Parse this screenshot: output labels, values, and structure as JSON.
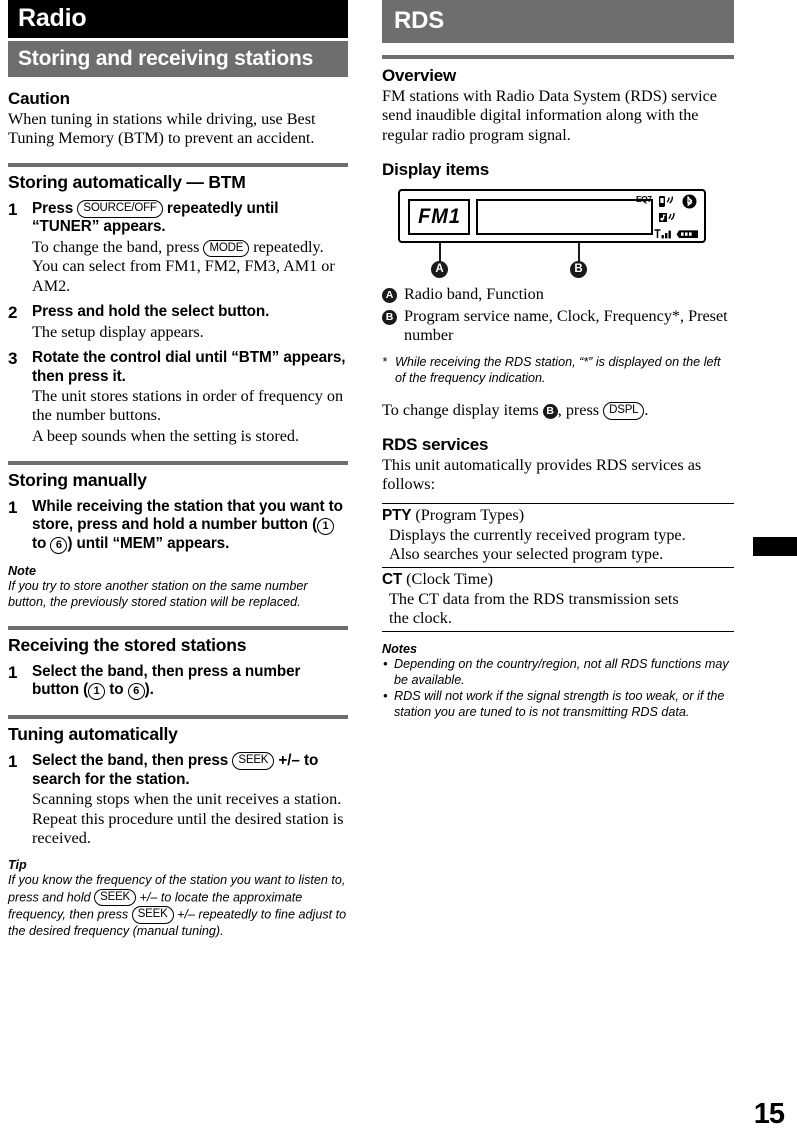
{
  "page_number": "15",
  "left_column": {
    "banner_title": "Radio",
    "banner_subtitle": "Storing and receiving stations",
    "caution": {
      "heading": "Caution",
      "text": "When tuning in stations while driving, use Best Tuning Memory (BTM) to prevent an accident."
    },
    "section_btm": {
      "heading": "Storing automatically — BTM",
      "steps": [
        {
          "num": "1",
          "title_pre": "Press",
          "button": "SOURCE/OFF",
          "title_post": "repeatedly until “TUNER” appears.",
          "desc_pre": "To change the band, press",
          "desc_button": "MODE",
          "desc_post": "repeatedly. You can select from FM1, FM2, FM3, AM1 or AM2."
        },
        {
          "num": "2",
          "title": "Press and hold the select button.",
          "desc": "The setup display appears."
        },
        {
          "num": "3",
          "title": "Rotate the control dial until “BTM” appears, then press it.",
          "desc": "The unit stores stations in order of frequency on the number buttons.",
          "desc2": "A beep sounds when the setting is stored."
        }
      ]
    },
    "section_manual": {
      "heading": "Storing manually",
      "step": {
        "num": "1",
        "title_pre": "While receiving the station that you want to store, press and hold a number button (",
        "btn_from": "1",
        "btn_mid": "to",
        "btn_to": "6",
        "title_post": ") until “MEM” appears."
      },
      "note_head": "Note",
      "note_body": "If you try to store another station on the same number button, the previously stored station will be replaced."
    },
    "section_receiving": {
      "heading": "Receiving the stored stations",
      "step": {
        "num": "1",
        "title_pre": "Select the band, then press a number button (",
        "btn_from": "1",
        "btn_mid": "to",
        "btn_to": "6",
        "title_post": ")."
      }
    },
    "section_tuning": {
      "heading": "Tuning automatically",
      "step": {
        "num": "1",
        "title_pre": "Select the band, then press",
        "button": "SEEK",
        "title_mid": "+/–",
        "title_post": "to search for the station.",
        "desc": "Scanning stops when the unit receives a station. Repeat this procedure until the desired station is received."
      },
      "tip_head": "Tip",
      "tip_part1": "If you know the frequency of the station you want to listen to, press and hold",
      "tip_btn1": "SEEK",
      "tip_part2": "+/– to locate the approximate frequency, then press",
      "tip_btn2": "SEEK",
      "tip_part3": "+/– repeatedly to fine adjust to the desired frequency (manual tuning)."
    }
  },
  "right_column": {
    "banner_title": "RDS",
    "overview": {
      "heading": "Overview",
      "text": "FM stations with Radio Data System (RDS) service send inaudible digital information along with the regular radio program signal."
    },
    "display_items": {
      "heading": "Display items",
      "lcd": {
        "band_text": "FM1",
        "eq_indicator": "EQ7"
      },
      "callout_a": "A",
      "callout_b": "B",
      "legend": [
        {
          "marker": "A",
          "text": "Radio band, Function"
        },
        {
          "marker": "B",
          "text": "Program service name, Clock, Frequency*, Preset number"
        }
      ],
      "footnote": "While receiving the RDS station, “*” is displayed on the left of the frequency indication.",
      "change_pre": "To change display items",
      "change_marker": "B",
      "change_mid": ", press",
      "change_button": "DSPL",
      "change_post": "."
    },
    "rds_services": {
      "heading": "RDS services",
      "intro": "This unit automatically provides RDS services as follows:",
      "rows": [
        {
          "term": "PTY",
          "term_suffix": "(Program Types)",
          "desc": "Displays the currently received program type.",
          "desc2": "Also searches your selected program type."
        },
        {
          "term": "CT",
          "term_suffix": "(Clock Time)",
          "desc": "The CT data from the RDS transmission sets",
          "desc2": "the clock."
        }
      ],
      "notes_head": "Notes",
      "notes": [
        "Depending on the country/region, not all RDS functions may be available.",
        "RDS will not work if the signal strength is too weak, or if the station you are tuned to is not transmitting RDS data."
      ]
    }
  }
}
